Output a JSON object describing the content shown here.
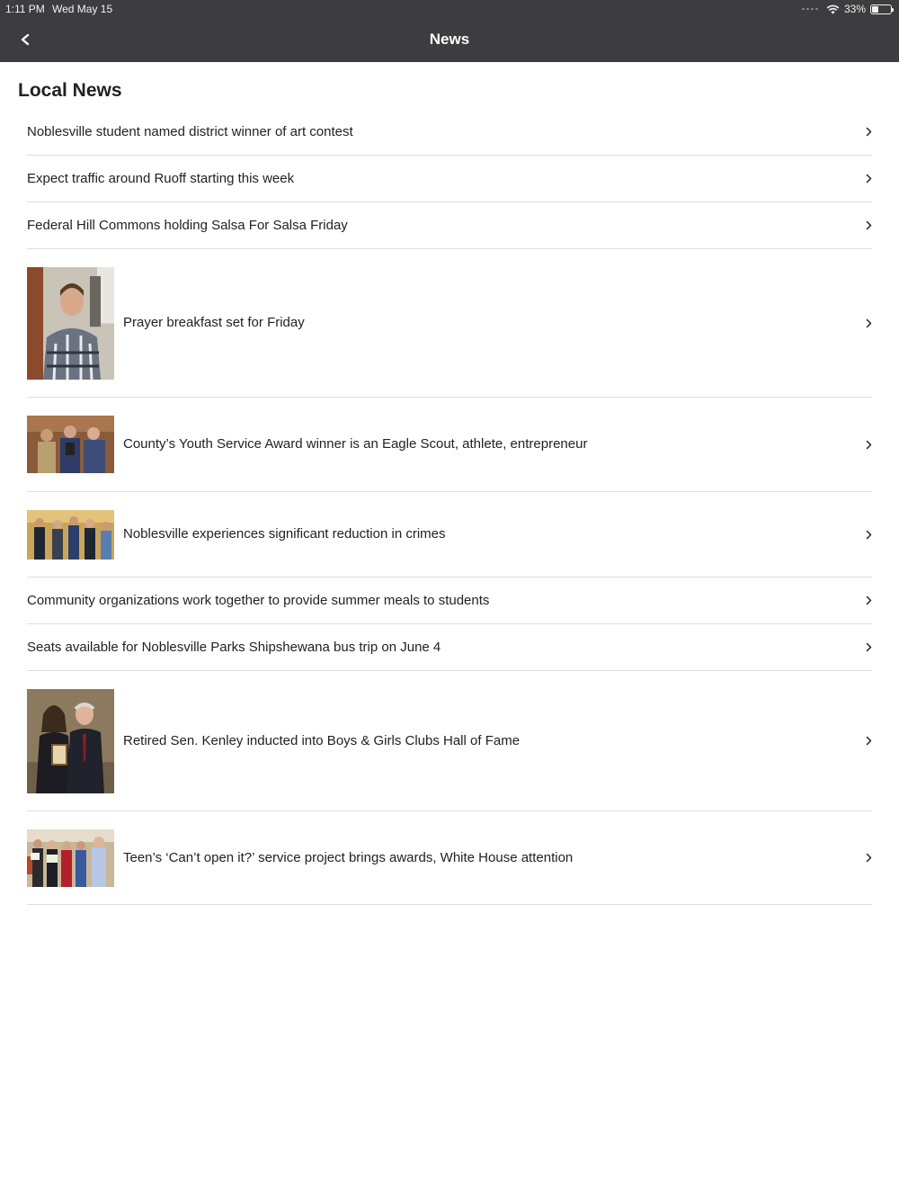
{
  "status": {
    "time": "1:11 PM",
    "date": "Wed May 15",
    "battery": "33%",
    "battery_level": 0.33
  },
  "nav": {
    "back_label": "<",
    "title": "News"
  },
  "section": {
    "title": "Local News"
  },
  "articles": [
    {
      "title": "Noblesville student named district winner of art contest"
    },
    {
      "title": "Expect traffic around Ruoff starting this week"
    },
    {
      "title": "Federal Hill Commons holding Salsa For Salsa Friday"
    },
    {
      "title": "Prayer breakfast set for Friday",
      "image": "portrait-photo"
    },
    {
      "title": "County’s Youth Service Award winner is an Eagle Scout, athlete, entrepreneur",
      "image": "award-photo"
    },
    {
      "title": "Noblesville experiences significant reduction in crimes",
      "image": "police-photo"
    },
    {
      "title": "Community organizations work together to provide summer meals to students"
    },
    {
      "title": "Seats available for Noblesville Parks Shipshewana bus trip on June 4"
    },
    {
      "title": "Retired Sen. Kenley inducted into Boys & Girls Clubs Hall of Fame",
      "image": "honoree-photo"
    },
    {
      "title": "Teen’s ‘Can’t open it?’ service project brings awards, White House attention",
      "image": "group-photo"
    }
  ]
}
